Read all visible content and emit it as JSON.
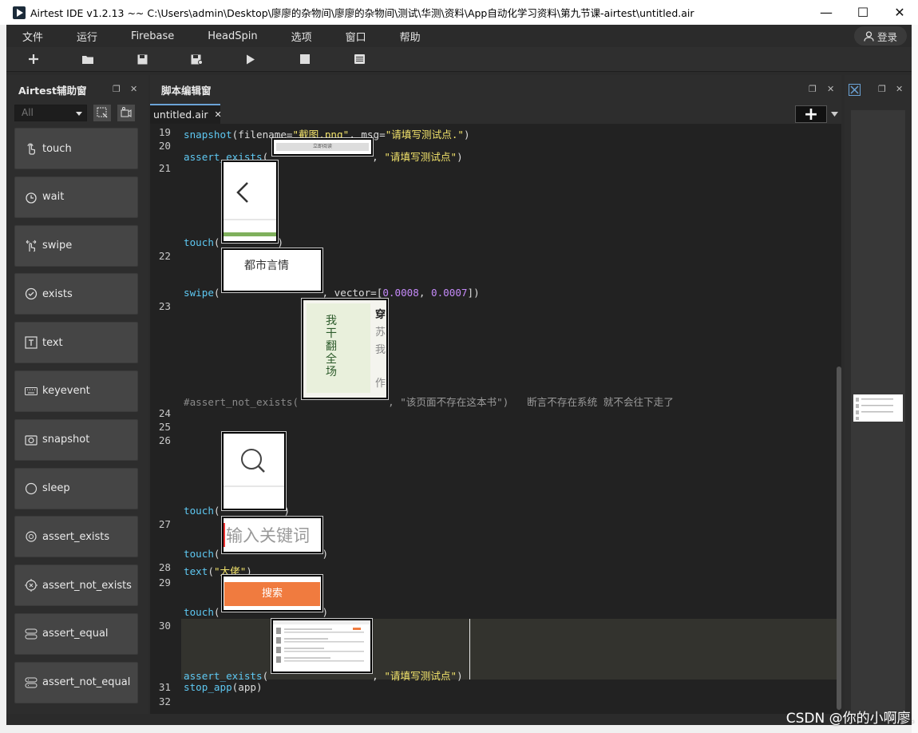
{
  "window": {
    "title": "Airtest IDE v1.2.13 ~~ C:\\Users\\admin\\Desktop\\廖廖的杂物间\\廖廖的杂物间\\测试\\华测\\资料\\App自动化学习资料\\第九节课-airtest\\untitled.air",
    "minimize": "—",
    "maximize": "☐",
    "close": "✕"
  },
  "menu": {
    "items": [
      "文件",
      "运行",
      "Firebase",
      "HeadSpin",
      "选项",
      "窗口",
      "帮助"
    ],
    "login": "登录"
  },
  "toolbar": {
    "icons": [
      "new-icon",
      "open-icon",
      "save-icon",
      "save-as-icon",
      "run-icon",
      "stop-icon",
      "log-icon"
    ]
  },
  "left_panel": {
    "title": "Airtest辅助窗",
    "filter": "All",
    "apis": [
      "touch",
      "wait",
      "swipe",
      "exists",
      "text",
      "keyevent",
      "snapshot",
      "sleep",
      "assert_exists",
      "assert_not_exists",
      "assert_equal",
      "assert_not_equal"
    ]
  },
  "editor": {
    "title": "脚本编辑窗",
    "tab": "untitled.air",
    "tab_close": "✕",
    "plus": "+",
    "line_numbers": [
      "19",
      "20",
      "21",
      "22",
      "23",
      "24",
      "25",
      "26",
      "27",
      "28",
      "29",
      "30",
      "31",
      "32"
    ],
    "lines": {
      "l19_fn": "snapshot",
      "l19_a": "(filename=",
      "l19_s1": "\"截图.png\"",
      "l19_b": ", msg=",
      "l19_s2": "\"请填写测试点.\"",
      "l19_c": ")",
      "l20_fn": "assert_exists",
      "l20_a": "(",
      "l20_b": ", ",
      "l20_s": "\"请填写测试点\"",
      "l20_c": ")",
      "l21_fn": "touch",
      "l21_a": "(",
      "l21_c": ")",
      "l22_fn": "swipe",
      "l22_a": "(",
      "l22_b": ", vector=[",
      "l22_n1": "0.0008",
      "l22_c": ", ",
      "l22_n2": "0.0007",
      "l22_d": "])",
      "l23_cm": "#assert_not_exists(",
      "l23_cm2": ", \"该页面不存在这本书\")   断言不存在系统 就不会往下走了",
      "l26_fn": "touch",
      "l26_a": "(",
      "l26_c": ")",
      "l27_fn": "touch",
      "l27_a": "(",
      "l27_c": ")",
      "l28_fn": "text",
      "l28_a": "(",
      "l28_s": "\"大佬\"",
      "l28_c": ")",
      "l29_fn": "touch",
      "l29_a": "(",
      "l29_c": ")",
      "l30_fn": "assert_exists",
      "l30_a": "(",
      "l30_b": ", ",
      "l30_s": "\"请填写测试点\"",
      "l30_c": ")",
      "l31_fn": "stop_app",
      "l31_a": "(app)"
    },
    "thumbs": {
      "t20": "立即阅读",
      "t22": "都市言情",
      "t23_a": "我",
      "t23_b": "干",
      "t23_c": "翻",
      "t23_d": "全",
      "t23_e": "场",
      "t23_side": "穿",
      "t23_side2": "苏",
      "t23_side3": "我",
      "t23_side4": "作",
      "t27": "输入关键词",
      "t29": "搜索"
    }
  },
  "watermark": "CSDN @你的小啊廖."
}
